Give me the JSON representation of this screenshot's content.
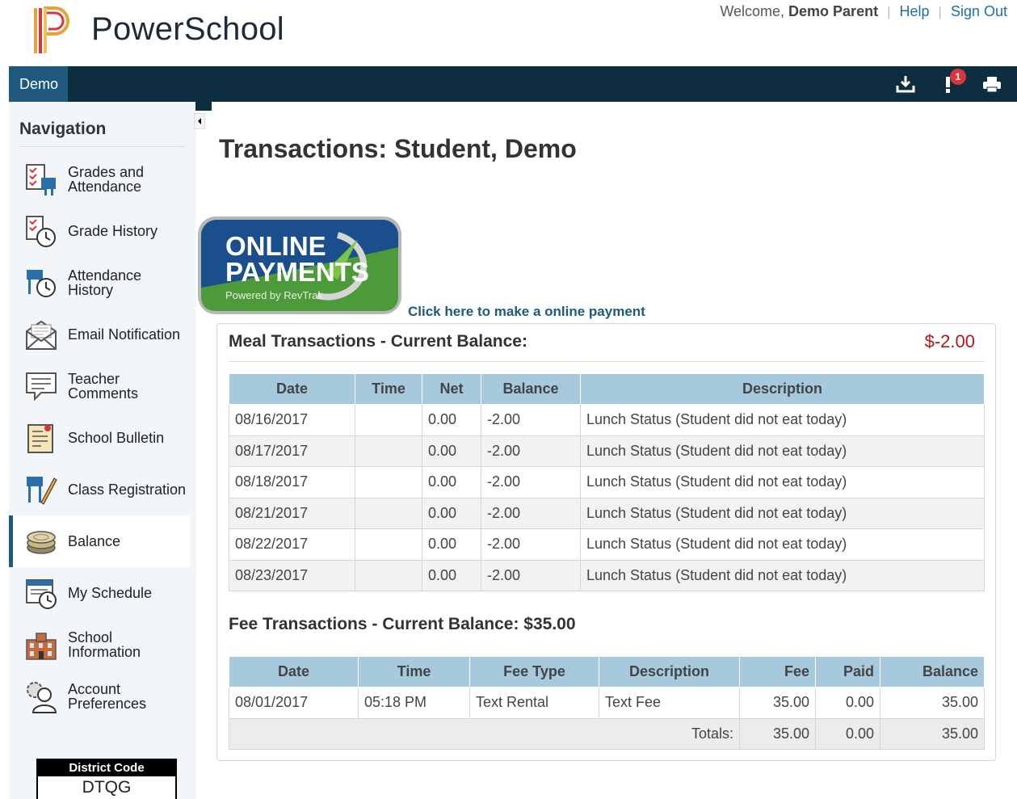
{
  "header": {
    "brand": "PowerSchool",
    "welcome_text": "Welcome,",
    "user_name": "Demo Parent",
    "help_label": "Help",
    "signout_label": "Sign Out"
  },
  "topbar": {
    "tab_label": "Demo",
    "notification_count": "1",
    "icons": [
      "download-icon",
      "alert-icon",
      "print-icon"
    ],
    "bar_color": "#0d2d40",
    "tab_color": "#1f5a7e"
  },
  "sidebar": {
    "title": "Navigation",
    "items": [
      {
        "label": "Grades and Attendance",
        "icon": "grades-attendance-icon"
      },
      {
        "label": "Grade History",
        "icon": "grade-history-icon"
      },
      {
        "label": "Attendance History",
        "icon": "attendance-history-icon"
      },
      {
        "label": "Email Notification",
        "icon": "email-icon"
      },
      {
        "label": "Teacher Comments",
        "icon": "comments-icon"
      },
      {
        "label": "School Bulletin",
        "icon": "bulletin-icon"
      },
      {
        "label": "Class Registration",
        "icon": "registration-icon"
      },
      {
        "label": "Balance",
        "icon": "coins-icon",
        "active": true
      },
      {
        "label": "My Schedule",
        "icon": "schedule-icon"
      },
      {
        "label": "School Information",
        "icon": "school-icon"
      },
      {
        "label": "Account Preferences",
        "icon": "account-preferences-icon"
      }
    ],
    "district_code_label": "District Code",
    "district_code": "DTQG"
  },
  "main": {
    "title": "Transactions: Student, Demo",
    "payment_badge": {
      "line1": "ONLINE",
      "line2": "PAYMENTS",
      "powered": "Powered by RevTrak"
    },
    "payment_link": "Click here to make a online payment",
    "meal": {
      "title": "Meal Transactions - Current Balance:",
      "balance": "$-2.00",
      "balance_color": "#b3161b",
      "columns": [
        "Date",
        "Time",
        "Net",
        "Balance",
        "Description"
      ],
      "rows": [
        [
          "08/16/2017",
          "",
          "0.00",
          "-2.00",
          "Lunch Status (Student did not eat today)"
        ],
        [
          "08/17/2017",
          "",
          "0.00",
          "-2.00",
          "Lunch Status (Student did not eat today)"
        ],
        [
          "08/18/2017",
          "",
          "0.00",
          "-2.00",
          "Lunch Status (Student did not eat today)"
        ],
        [
          "08/21/2017",
          "",
          "0.00",
          "-2.00",
          "Lunch Status (Student did not eat today)"
        ],
        [
          "08/22/2017",
          "",
          "0.00",
          "-2.00",
          "Lunch Status (Student did not eat today)"
        ],
        [
          "08/23/2017",
          "",
          "0.00",
          "-2.00",
          "Lunch Status (Student did not eat today)"
        ]
      ]
    },
    "fee": {
      "title": "Fee Transactions - Current Balance: $35.00",
      "columns": [
        "Date",
        "Time",
        "Fee Type",
        "Description",
        "Fee",
        "Paid",
        "Balance"
      ],
      "rows": [
        [
          "08/01/2017",
          "05:18 PM",
          "Text Rental",
          "Text Fee",
          "35.00",
          "0.00",
          "35.00"
        ]
      ],
      "totals_label": "Totals:",
      "totals": [
        "35.00",
        "0.00",
        "35.00"
      ]
    }
  }
}
